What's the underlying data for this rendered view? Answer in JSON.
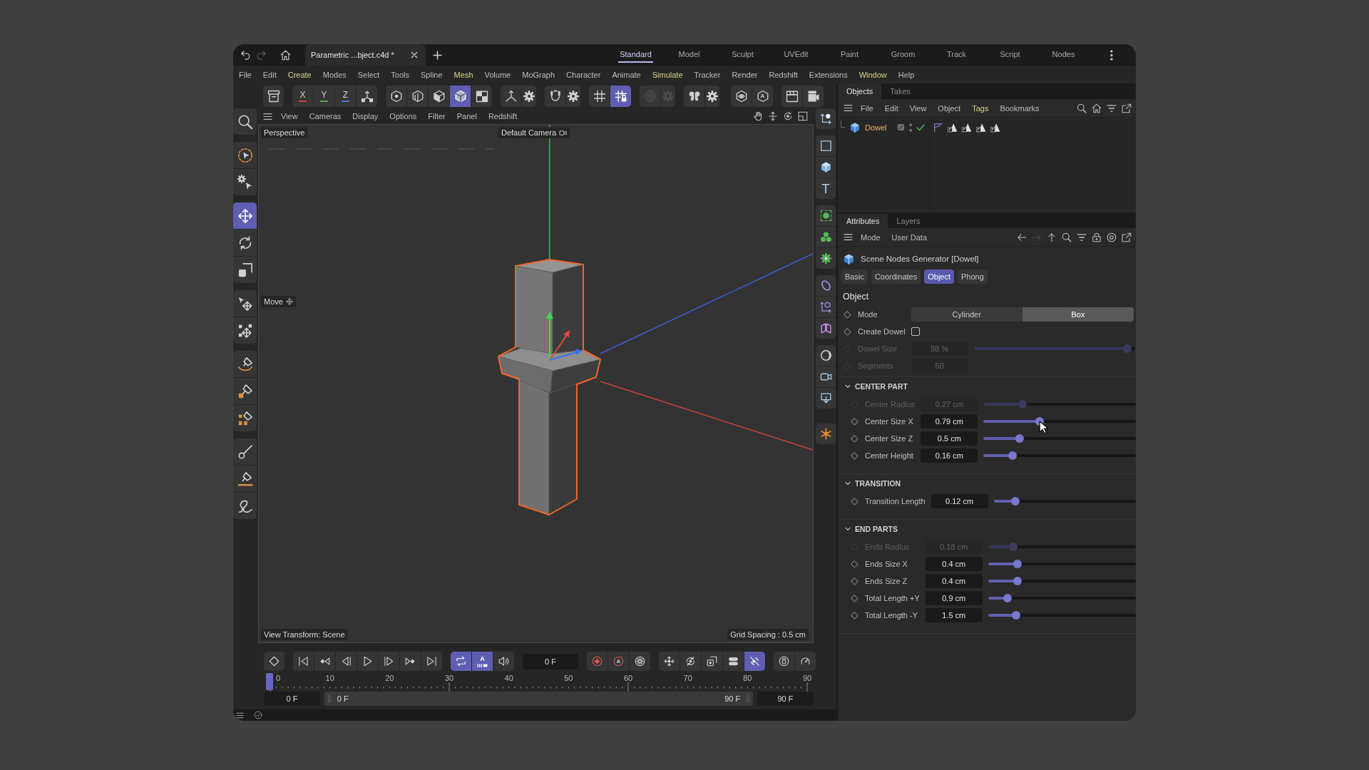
{
  "title_bar": {
    "history": [
      {
        "disabled": false
      },
      {
        "disabled": true
      }
    ],
    "document_tabs": [
      {
        "label": "Parametric ...bject.c4d *",
        "selected": true
      }
    ],
    "layouts": [
      {
        "label": "Standard",
        "selected": true
      },
      {
        "label": "Model",
        "selected": false
      },
      {
        "label": "Sculpt",
        "selected": false
      },
      {
        "label": "UVEdit",
        "selected": false
      },
      {
        "label": "Paint",
        "selected": false
      },
      {
        "label": "Groom",
        "selected": false
      },
      {
        "label": "Track",
        "selected": false
      },
      {
        "label": "Script",
        "selected": false
      },
      {
        "label": "Nodes",
        "selected": false
      }
    ]
  },
  "menu_bar": [
    {
      "label": "File",
      "highlighted": false
    },
    {
      "label": "Edit",
      "highlighted": false
    },
    {
      "label": "Create",
      "highlighted": true
    },
    {
      "label": "Modes",
      "highlighted": false
    },
    {
      "label": "Select",
      "highlighted": false
    },
    {
      "label": "Tools",
      "highlighted": false
    },
    {
      "label": "Spline",
      "highlighted": false
    },
    {
      "label": "Mesh",
      "highlighted": true
    },
    {
      "label": "Volume",
      "highlighted": false
    },
    {
      "label": "MoGraph",
      "highlighted": false
    },
    {
      "label": "Character",
      "highlighted": false
    },
    {
      "label": "Animate",
      "highlighted": false
    },
    {
      "label": "Simulate",
      "highlighted": true
    },
    {
      "label": "Tracker",
      "highlighted": false
    },
    {
      "label": "Render",
      "highlighted": false
    },
    {
      "label": "Redshift",
      "highlighted": false
    },
    {
      "label": "Extensions",
      "highlighted": false
    },
    {
      "label": "Window",
      "highlighted": true
    },
    {
      "label": "Help",
      "highlighted": false
    }
  ],
  "toolbar": [
    [
      {
        "kind": "icon",
        "active": false,
        "disabled": false
      }
    ],
    [
      {
        "kind": "letter",
        "label": "X",
        "color": "#c94a44",
        "active": false,
        "disabled": false
      },
      {
        "kind": "letter",
        "label": "Y",
        "color": "#5aa84f",
        "active": false,
        "disabled": false
      },
      {
        "kind": "letter",
        "label": "Z",
        "color": "#4a7bd0",
        "active": false,
        "disabled": false
      },
      {
        "kind": "icon",
        "active": false,
        "disabled": false
      }
    ],
    [
      {
        "kind": "icon",
        "active": false,
        "disabled": false
      },
      {
        "kind": "icon",
        "active": false,
        "disabled": false
      },
      {
        "kind": "icon",
        "active": false,
        "disabled": false
      },
      {
        "kind": "icon",
        "active": true,
        "disabled": false
      },
      {
        "kind": "icon",
        "active": false,
        "disabled": false
      }
    ],
    [
      {
        "kind": "icon",
        "active": false,
        "disabled": false
      },
      {
        "kind": "icon",
        "active": false,
        "disabled": false
      }
    ],
    [
      {
        "kind": "icon",
        "active": false,
        "disabled": false
      },
      {
        "kind": "icon",
        "active": false,
        "disabled": false
      }
    ],
    [
      {
        "kind": "icon",
        "active": false,
        "disabled": false
      },
      {
        "kind": "icon",
        "active": true,
        "disabled": false
      }
    ],
    [
      {
        "kind": "icon",
        "active": false,
        "disabled": true
      },
      {
        "kind": "icon",
        "active": false,
        "disabled": true
      }
    ],
    [
      {
        "kind": "icon",
        "active": false,
        "disabled": false
      },
      {
        "kind": "icon",
        "active": false,
        "disabled": false
      }
    ],
    [
      {
        "kind": "icon",
        "active": false,
        "disabled": false
      },
      {
        "kind": "badge",
        "label": "A",
        "active": false,
        "disabled": false
      }
    ],
    [
      {
        "kind": "icon",
        "active": false,
        "disabled": false
      },
      {
        "kind": "icon",
        "active": false,
        "disabled": false
      }
    ]
  ],
  "left_tools": [
    [
      {
        "kind": "icon",
        "active": false,
        "disabled": false
      }
    ],
    [
      {
        "kind": "icon",
        "active": false,
        "disabled": false
      },
      {
        "kind": "icon",
        "active": false,
        "disabled": false
      }
    ],
    [
      {
        "kind": "icon",
        "active": true,
        "disabled": false
      },
      {
        "kind": "icon",
        "active": false,
        "disabled": false
      },
      {
        "kind": "icon",
        "active": false,
        "disabled": false
      }
    ],
    [
      {
        "kind": "icon",
        "active": false,
        "disabled": false
      },
      {
        "kind": "icon",
        "active": false,
        "disabled": false
      }
    ],
    [
      {
        "kind": "icon",
        "active": false,
        "disabled": false
      },
      {
        "kind": "icon",
        "active": false,
        "disabled": false
      },
      {
        "kind": "icon",
        "active": false,
        "disabled": false
      }
    ],
    [
      {
        "kind": "icon",
        "active": false,
        "disabled": false
      },
      {
        "kind": "icon",
        "active": false,
        "disabled": false
      },
      {
        "kind": "icon",
        "active": false,
        "disabled": false
      }
    ]
  ],
  "viewport": {
    "menu": [
      "View",
      "Cameras",
      "Display",
      "Options",
      "Filter",
      "Panel",
      "Redshift"
    ],
    "projection": "Perspective",
    "camera": "Default Camera",
    "tool": "Move",
    "view_transform": "View Transform: Scene",
    "grid_spacing": "Grid Spacing : 0.5 cm"
  },
  "right_tools": [
    [
      {
        "kind": "icon",
        "active": false,
        "disabled": false
      }
    ],
    [
      {
        "kind": "icon",
        "active": false,
        "disabled": false
      },
      {
        "kind": "icon",
        "active": false,
        "disabled": false
      },
      {
        "kind": "letter",
        "label": "T",
        "active": false,
        "disabled": false
      }
    ],
    [
      {
        "kind": "icon",
        "active": false,
        "disabled": false
      },
      {
        "kind": "icon",
        "active": false,
        "disabled": false
      },
      {
        "kind": "icon",
        "active": false,
        "disabled": false
      }
    ],
    [
      {
        "kind": "icon",
        "active": false,
        "disabled": false
      },
      {
        "kind": "icon",
        "active": false,
        "disabled": false
      },
      {
        "kind": "icon",
        "active": false,
        "disabled": false
      }
    ],
    [
      {
        "kind": "icon",
        "active": false,
        "disabled": false
      },
      {
        "kind": "icon",
        "active": false,
        "disabled": false
      },
      {
        "kind": "icon",
        "active": false,
        "disabled": false
      }
    ],
    [
      {
        "kind": "icon",
        "active": false,
        "disabled": false
      }
    ]
  ],
  "timeline": {
    "controls": [
      [
        {
          "kind": "icon",
          "active": false,
          "disabled": false
        }
      ],
      [
        {
          "kind": "icon",
          "active": false,
          "disabled": false
        },
        {
          "kind": "icon",
          "active": false,
          "disabled": false
        },
        {
          "kind": "icon",
          "active": false,
          "disabled": false
        },
        {
          "kind": "icon",
          "active": false,
          "disabled": false
        },
        {
          "kind": "icon",
          "active": false,
          "disabled": false
        },
        {
          "kind": "icon",
          "active": false,
          "disabled": false
        },
        {
          "kind": "icon",
          "active": false,
          "disabled": false
        }
      ],
      [
        {
          "kind": "icon",
          "active": true,
          "disabled": false
        },
        {
          "kind": "stacked",
          "label": "A",
          "active": true,
          "disabled": false
        },
        {
          "kind": "icon",
          "active": false,
          "disabled": false
        }
      ]
    ],
    "frame_field": "0 F",
    "key_controls": [
      [
        {
          "kind": "icon",
          "active": false,
          "disabled": false
        },
        {
          "kind": "badge",
          "label": "A",
          "active": false,
          "disabled": false
        },
        {
          "kind": "icon",
          "active": false,
          "disabled": false
        }
      ],
      [
        {
          "kind": "icon",
          "active": false,
          "disabled": false
        },
        {
          "kind": "icon",
          "active": false,
          "disabled": false
        },
        {
          "kind": "icon",
          "active": false,
          "disabled": false
        },
        {
          "kind": "icon",
          "active": false,
          "disabled": false
        },
        {
          "kind": "icon",
          "active": true,
          "disabled": false
        }
      ],
      [
        {
          "kind": "icon",
          "active": false,
          "disabled": false
        },
        {
          "kind": "icon",
          "active": false,
          "disabled": false
        }
      ]
    ],
    "ruler_labels": [
      "0",
      "10",
      "20",
      "30",
      "40",
      "50",
      "60",
      "70",
      "80",
      "90"
    ],
    "range": {
      "start_field": "0 F",
      "start": "0 F",
      "end": "90 F",
      "end_field": "90 F"
    }
  },
  "objects_panel": {
    "tabs": [
      {
        "label": "Objects",
        "selected": true
      },
      {
        "label": "Takes",
        "selected": false
      }
    ],
    "menu": [
      {
        "label": "File",
        "highlighted": false
      },
      {
        "label": "Edit",
        "highlighted": false
      },
      {
        "label": "View",
        "highlighted": false
      },
      {
        "label": "Object",
        "highlighted": false
      },
      {
        "label": "Tags",
        "highlighted": true
      },
      {
        "label": "Bookmarks",
        "highlighted": false
      }
    ],
    "objects": [
      {
        "name": "Dowel",
        "selected": true,
        "enabled": true
      }
    ]
  },
  "attributes_panel": {
    "tabs": [
      {
        "label": "Attributes",
        "selected": true
      },
      {
        "label": "Layers",
        "selected": false
      }
    ],
    "menu": [
      "Mode",
      "User Data"
    ],
    "nav_buttons": [
      {
        "disabled": false
      },
      {
        "disabled": true
      },
      {
        "disabled": false
      },
      {
        "disabled": false
      },
      {
        "disabled": false
      },
      {
        "disabled": false
      },
      {
        "disabled": false
      },
      {
        "disabled": false
      }
    ],
    "object_title": "Scene Nodes Generator [Dowel]",
    "pages": [
      {
        "label": "Basic",
        "selected": false
      },
      {
        "label": "Coordinates",
        "selected": false
      },
      {
        "label": "Object",
        "selected": true
      },
      {
        "label": "Phong",
        "selected": false
      }
    ],
    "section_title": "Object",
    "params": [
      {
        "kind": "segmented",
        "label": "Mode",
        "disabled": false,
        "options": [
          {
            "label": "Cylinder",
            "selected": false
          },
          {
            "label": "Box",
            "selected": true
          }
        ]
      },
      {
        "kind": "checkbox",
        "label": "Create Dowel",
        "disabled": false,
        "checked": false
      },
      {
        "kind": "slider",
        "label": "Dowel Size",
        "disabled": true,
        "value": "98 %",
        "level": 0.98
      },
      {
        "kind": "number",
        "label": "Segments",
        "disabled": true,
        "value": "50"
      }
    ],
    "groups": [
      {
        "title": "CENTER PART",
        "expanded": true,
        "params": [
          {
            "kind": "slider",
            "label": "Center Radius",
            "disabled": true,
            "value": "0.27 cm",
            "level": 0.24
          },
          {
            "kind": "slider",
            "label": "Center Size X",
            "disabled": false,
            "value": "0.79 cm",
            "level": 0.36
          },
          {
            "kind": "slider",
            "label": "Center Size Z",
            "disabled": false,
            "value": "0.5 cm",
            "level": 0.22
          },
          {
            "kind": "slider",
            "label": "Center Height",
            "disabled": false,
            "value": "0.16 cm",
            "level": 0.17
          }
        ]
      },
      {
        "title": "TRANSITION",
        "expanded": true,
        "params": [
          {
            "kind": "slider",
            "label": "Transition Length",
            "disabled": false,
            "value": "0.12 cm",
            "level": 0.13
          }
        ]
      },
      {
        "title": "END PARTS",
        "expanded": true,
        "params": [
          {
            "kind": "slider",
            "label": "Ends Radius",
            "disabled": true,
            "value": "0.18 cm",
            "level": 0.15
          },
          {
            "kind": "slider",
            "label": "Ends Size X",
            "disabled": false,
            "value": "0.4 cm",
            "level": 0.18
          },
          {
            "kind": "slider",
            "label": "Ends Size Z",
            "disabled": false,
            "value": "0.4 cm",
            "level": 0.18
          },
          {
            "kind": "slider",
            "label": "Total Length +Y",
            "disabled": false,
            "value": "0.9 cm",
            "level": 0.11
          },
          {
            "kind": "slider",
            "label": "Total Length -Y",
            "disabled": false,
            "value": "1.5 cm",
            "level": 0.17
          }
        ]
      }
    ]
  }
}
